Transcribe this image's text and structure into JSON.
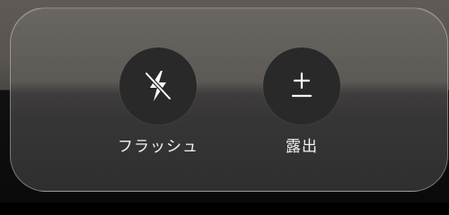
{
  "controls": [
    {
      "id": "flash",
      "label": "フラッシュ",
      "icon": "flash-off-icon"
    },
    {
      "id": "exposure",
      "label": "露出",
      "icon": "exposure-plus-minus-icon"
    }
  ],
  "exposure_icon_glyph": "±",
  "colors": {
    "panel": "#3a3938",
    "circle": "#2a2929",
    "label": "#f2f2f2"
  }
}
